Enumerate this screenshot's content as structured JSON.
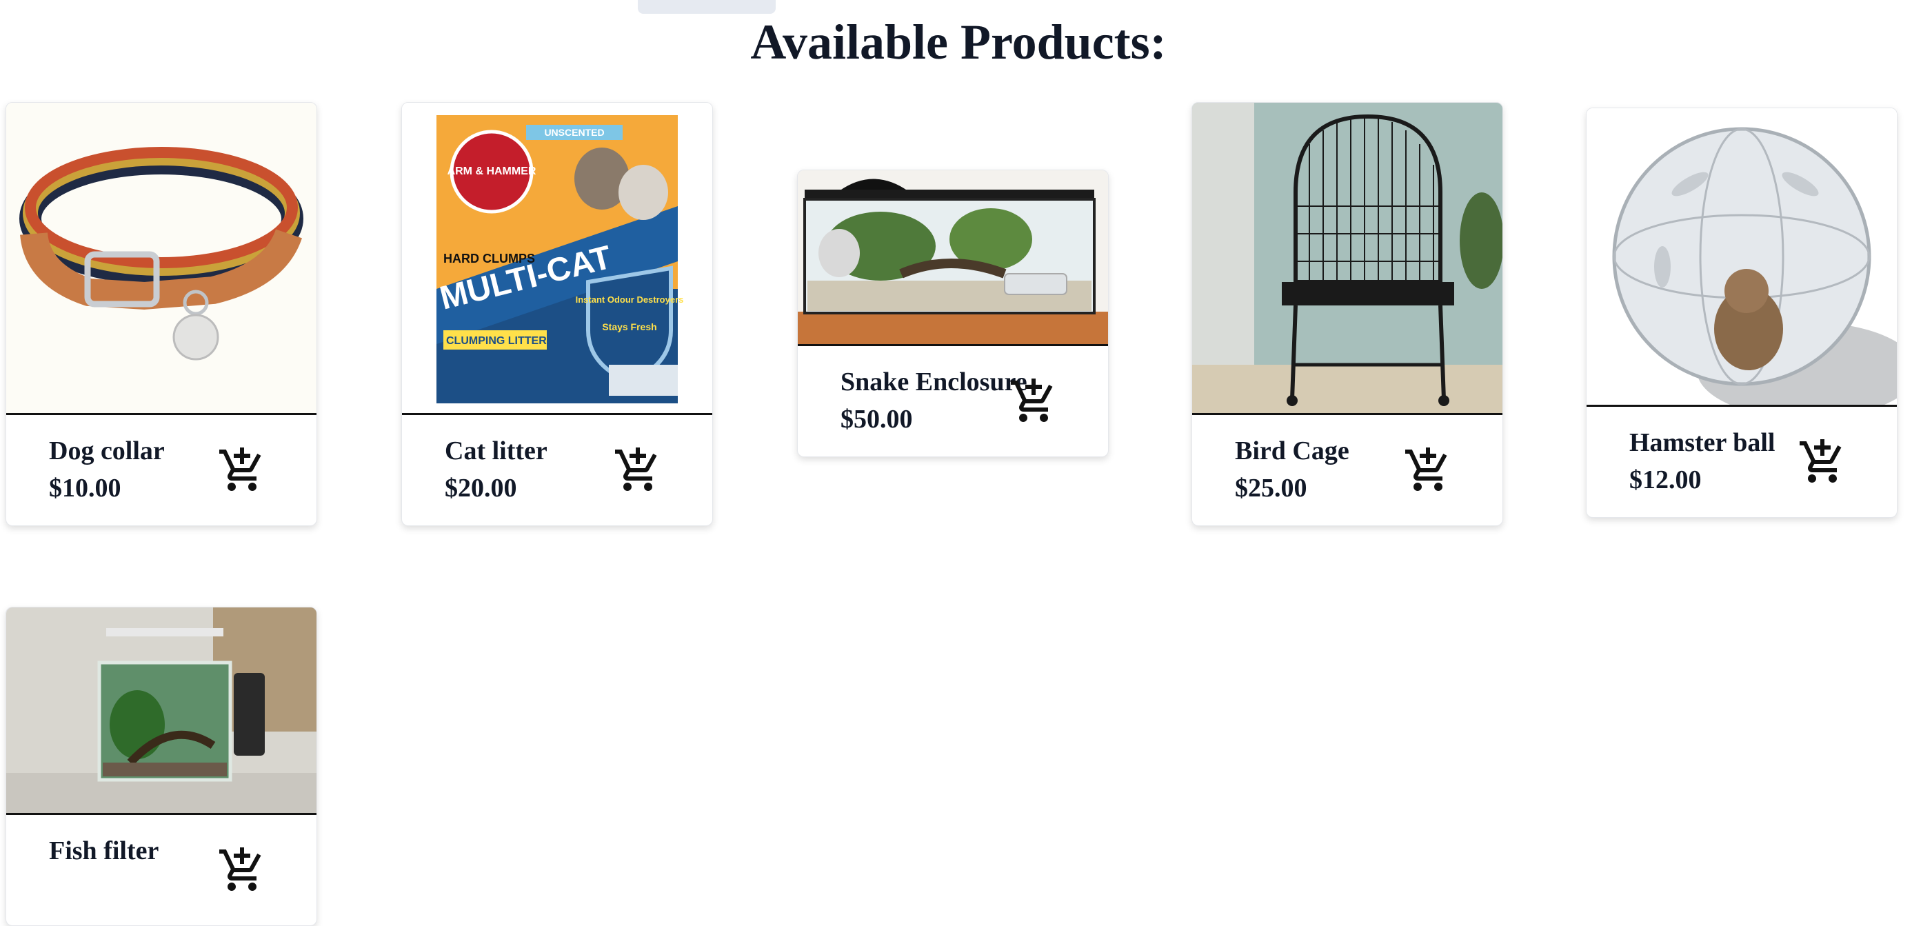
{
  "page": {
    "title": "Available Products:"
  },
  "products": [
    {
      "name": "Dog collar",
      "price": "$10.00",
      "image": "dog-collar-photo",
      "cart_icon": "add-to-cart-icon"
    },
    {
      "name": "Cat litter",
      "price": "$20.00",
      "image": "cat-litter-box-photo",
      "cart_icon": "add-to-cart-icon",
      "image_text": {
        "brand": "ARM & HAMMER",
        "product": "MULTI-CAT",
        "variant": "UNSCENTED",
        "tag1": "HARD CLUMPS",
        "tag2": "CLUMPING LITTER",
        "badge1": "Instant Odour Destroyers",
        "badge2": "Stays Fresh"
      }
    },
    {
      "name": "Snake Enclosure",
      "price": "$50.00",
      "image": "snake-terrarium-photo",
      "cart_icon": "add-to-cart-icon"
    },
    {
      "name": "Bird Cage",
      "price": "$25.00",
      "image": "bird-cage-photo",
      "cart_icon": "add-to-cart-icon"
    },
    {
      "name": "Hamster ball",
      "price": "$12.00",
      "image": "hamster-ball-photo",
      "cart_icon": "add-to-cart-icon"
    },
    {
      "name": "Fish filter",
      "price": "",
      "image": "fish-aquarium-photo",
      "cart_icon": "add-to-cart-icon"
    }
  ]
}
